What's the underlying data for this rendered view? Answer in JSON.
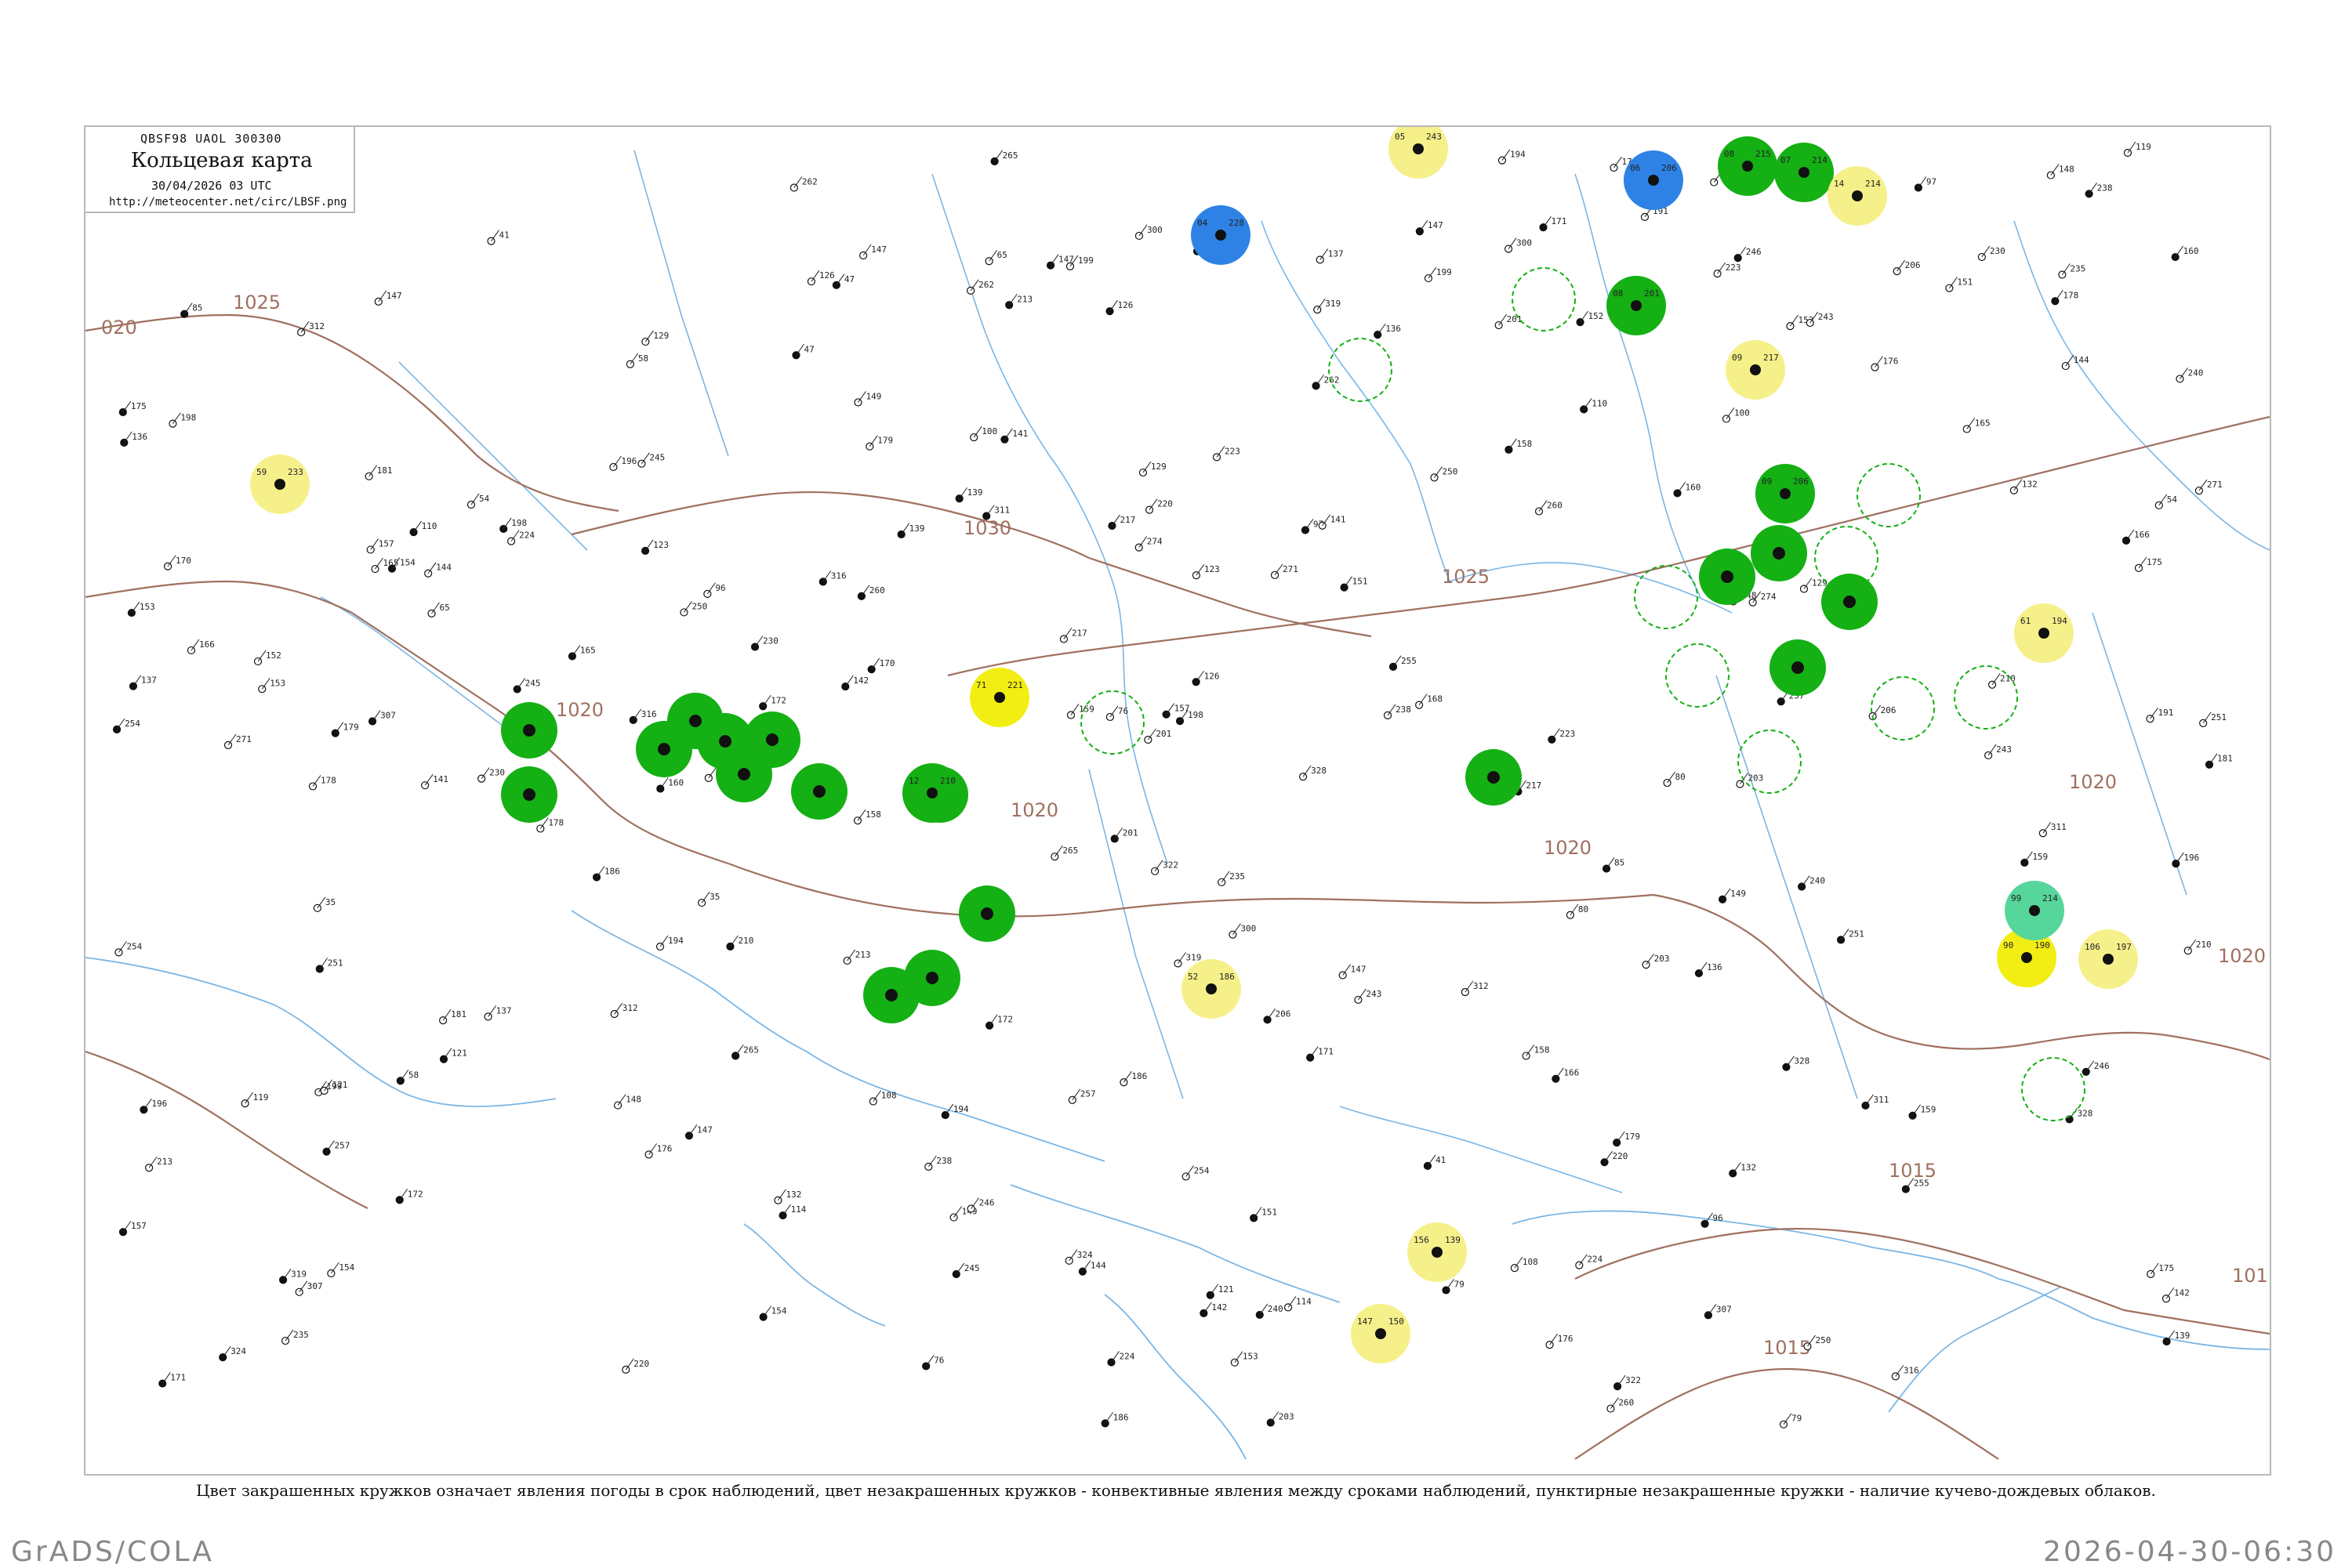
{
  "header": {
    "code": "QBSF98  UAOL  300300",
    "title": "Кольцевая карта",
    "date": "30/04/2026 03 UTC",
    "url": "http://meteocenter.net/circ/LBSF.png"
  },
  "caption": "Цвет закрашенных кружков означает явления погоды в срок наблюдений, цвет незакрашенных кружков - конвективные явления между сроками наблюдений, пунктирные незакрашенные кружки - наличие кучево-дождевых облаков.",
  "footer": {
    "left": "GrADS/COLA",
    "right": "2026-04-30-06:30"
  },
  "isobar_labels": [
    "1025",
    "020",
    "1020",
    "1030",
    "1025",
    "1020",
    "1020",
    "1020",
    "1015",
    "1015",
    "1020",
    "101"
  ],
  "colors": {
    "green": "#14b014",
    "yellow": "#f6f08a",
    "bright_yellow": "#f2ee14",
    "blue": "#2e82e6",
    "teal": "#56d69a",
    "isobar": "#a07060",
    "water": "#7ab6e6"
  },
  "legend_meaning": {
    "filled_circle": "явления погоды в срок наблюдений",
    "open_circle": "конвективные явления между сроками наблюдений",
    "dashed_circle": "наличие кучево-дождевых облаков"
  },
  "stations": [
    {
      "id": "s1",
      "kind": "green",
      "t": "08",
      "p": "215"
    },
    {
      "id": "s2",
      "kind": "green",
      "t": "07",
      "p": "214"
    },
    {
      "id": "s3",
      "kind": "blue",
      "t": "06",
      "p": "206"
    },
    {
      "id": "s4",
      "kind": "yellow",
      "t": "05",
      "p": "243"
    },
    {
      "id": "s5",
      "kind": "yellow",
      "t": "14",
      "p": "214"
    },
    {
      "id": "s6",
      "kind": "green",
      "t": "08",
      "p": "201"
    },
    {
      "id": "s7",
      "kind": "yellow",
      "t": "09",
      "p": "217"
    },
    {
      "id": "s8",
      "kind": "blue",
      "t": "04",
      "p": "228"
    },
    {
      "id": "s9",
      "kind": "green",
      "t": "09",
      "p": "206"
    },
    {
      "id": "s10",
      "kind": "yellow",
      "t": "59",
      "p": "233"
    },
    {
      "id": "s11",
      "kind": "yellow",
      "t": "61",
      "p": "194"
    },
    {
      "id": "s12",
      "kind": "bright_yellow",
      "t": "71",
      "p": "221"
    },
    {
      "id": "s13",
      "kind": "green",
      "t": "12",
      "p": "210"
    },
    {
      "id": "s14",
      "kind": "yellow",
      "t": "52",
      "p": "186"
    },
    {
      "id": "s15",
      "kind": "bright_yellow",
      "t": "90",
      "p": "190"
    },
    {
      "id": "s16",
      "kind": "teal",
      "t": "99",
      "p": "214"
    },
    {
      "id": "s17",
      "kind": "yellow",
      "t": "106",
      "p": "197"
    },
    {
      "id": "s18",
      "kind": "yellow",
      "t": "156",
      "p": "139"
    },
    {
      "id": "s19",
      "kind": "yellow",
      "t": "147",
      "p": "150"
    }
  ],
  "plain_values": [
    "322",
    "316",
    "319",
    "311",
    "300",
    "312",
    "328",
    "324",
    "307",
    "245",
    "260",
    "251",
    "271",
    "274",
    "235",
    "243",
    "255",
    "201",
    "199",
    "172",
    "175",
    "157",
    "159",
    "148",
    "147",
    "139",
    "136",
    "170",
    "165",
    "160",
    "153",
    "147",
    "144",
    "126",
    "132",
    "121",
    "108",
    "176",
    "168",
    "151",
    "141",
    "110",
    "179",
    "152",
    "254",
    "262",
    "265",
    "257",
    "246",
    "250",
    "230",
    "224",
    "238",
    "240",
    "213",
    "217",
    "223",
    "210",
    "220",
    "203",
    "206",
    "196",
    "194",
    "198",
    "191",
    "186",
    "181",
    "178",
    "171",
    "166",
    "158",
    "154",
    "149",
    "142",
    "137",
    "129",
    "123",
    "119",
    "114",
    "100",
    "85",
    "97",
    "96",
    "80",
    "79",
    "76",
    "65",
    "58",
    "54",
    "47",
    "41",
    "35"
  ]
}
